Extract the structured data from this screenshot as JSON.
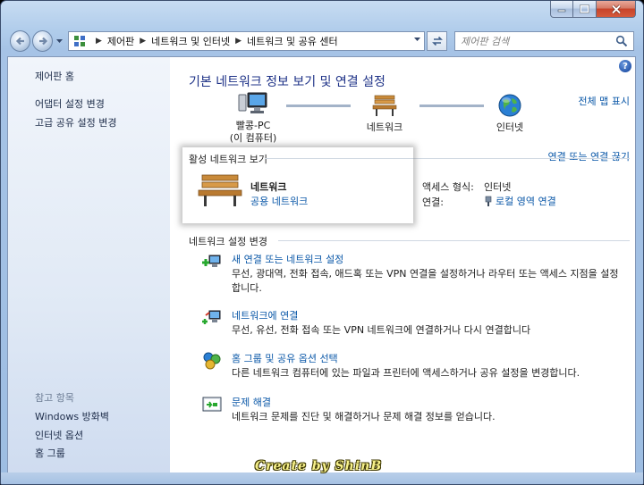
{
  "window": {
    "colors": {
      "accent": "#1e3287",
      "link": "#0b58a8",
      "close": "#c7432a"
    }
  },
  "address_bar": {
    "breadcrumbs": [
      "제어판",
      "네트워크 및 인터넷",
      "네트워크 및 공유 센터"
    ],
    "search_placeholder": "제어판 검색"
  },
  "sidebar": {
    "home": "제어판 홈",
    "links": [
      "어댑터 설정 변경",
      "고급 공유 설정 변경"
    ],
    "see_also_heading": "참고 항목",
    "see_also": [
      "Windows 방화벽",
      "인터넷 옵션",
      "홈 그룹"
    ]
  },
  "main": {
    "title": "기본 네트워크 정보 보기 및 연결 설정",
    "full_map_link": "전체 맵 표시",
    "map": {
      "computer_name": "빨콩-PC",
      "computer_sub": "(이 컴퓨터)",
      "network": "네트워크",
      "internet": "인터넷"
    },
    "active": {
      "heading": "활성 네트워크 보기",
      "disconnect_link": "연결 또는 연결 끊기",
      "network_name": "네트워크",
      "network_type": "공용 네트워크",
      "access_label": "액세스 형식:",
      "access_value": "인터넷",
      "connection_label": "연결:",
      "connection_value": "로컬 영역 연결"
    },
    "settings": {
      "heading": "네트워크 설정 변경",
      "tasks": [
        {
          "icon": "new-connection-icon",
          "title": "새 연결 또는 네트워크 설정",
          "desc": "무선, 광대역, 전화 접속, 애드혹 또는 VPN 연결을 설정하거나 라우터 또는 액세스 지점을 설정합니다."
        },
        {
          "icon": "connect-network-icon",
          "title": "네트워크에 연결",
          "desc": "무선, 유선, 전화 접속 또는 VPN 네트워크에 연결하거나 다시 연결합니다"
        },
        {
          "icon": "homegroup-icon",
          "title": "홈 그룹 및 공유 옵션 선택",
          "desc": "다른 네트워크 컴퓨터에 있는 파일과 프린터에 액세스하거나 공유 설정을 변경합니다."
        },
        {
          "icon": "troubleshoot-icon",
          "title": "문제 해결",
          "desc": "네트워크 문제를 진단 및 해결하거나 문제 해결 정보를 얻습니다."
        }
      ]
    }
  },
  "watermark": "Create by ShinB"
}
